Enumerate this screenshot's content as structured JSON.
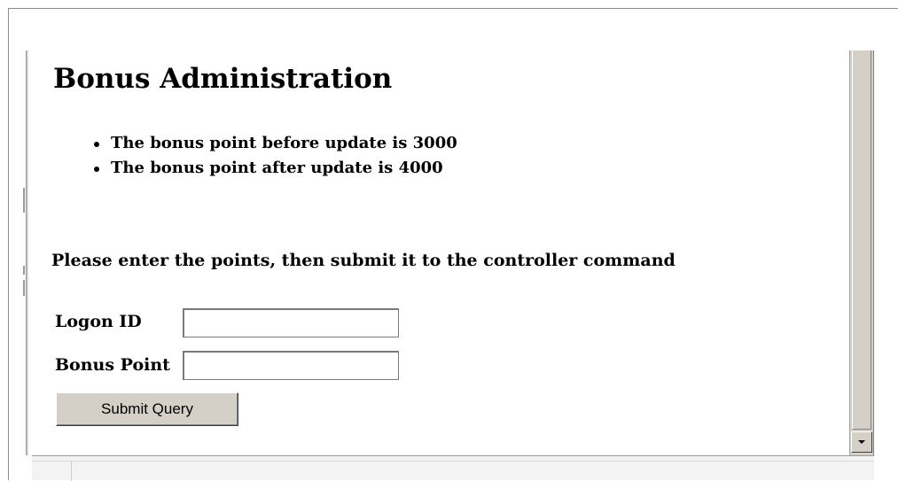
{
  "page": {
    "title": "Bonus Administration",
    "status_items": [
      "The bonus point before update is 3000",
      "The bonus point after update is 4000"
    ],
    "instruction": "Please enter the points, then submit it to the controller command"
  },
  "form": {
    "logon_id_label": "Logon ID",
    "logon_id_value": "",
    "bonus_point_label": "Bonus Point",
    "bonus_point_value": "",
    "submit_label": "Submit Query"
  },
  "icons": {
    "scroll_down": "chevron-down-icon"
  },
  "colors": {
    "chrome": "#d4d0c8",
    "text": "#000000",
    "background": "#ffffff"
  }
}
